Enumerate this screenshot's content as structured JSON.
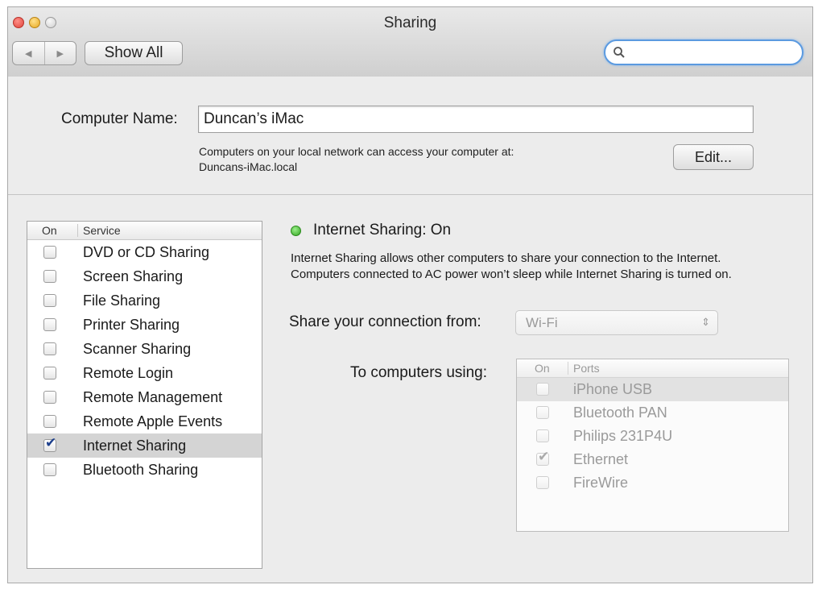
{
  "window": {
    "title": "Sharing",
    "nav_back": "◀",
    "nav_forward": "▶",
    "show_all_label": "Show All",
    "search_placeholder": "",
    "search_value": ""
  },
  "computer_name": {
    "label": "Computer Name:",
    "value": "Duncan’s iMac",
    "access_line1": "Computers on your local network can access your computer at:",
    "access_line2": "Duncans-iMac.local",
    "edit_label": "Edit..."
  },
  "services": {
    "header_on": "On",
    "header_service": "Service",
    "items": [
      {
        "label": "DVD or CD Sharing",
        "checked": false,
        "selected": false
      },
      {
        "label": "Screen Sharing",
        "checked": false,
        "selected": false
      },
      {
        "label": "File Sharing",
        "checked": false,
        "selected": false
      },
      {
        "label": "Printer Sharing",
        "checked": false,
        "selected": false
      },
      {
        "label": "Scanner Sharing",
        "checked": false,
        "selected": false
      },
      {
        "label": "Remote Login",
        "checked": false,
        "selected": false
      },
      {
        "label": "Remote Management",
        "checked": false,
        "selected": false
      },
      {
        "label": "Remote Apple Events",
        "checked": false,
        "selected": false
      },
      {
        "label": "Internet Sharing",
        "checked": true,
        "selected": true
      },
      {
        "label": "Bluetooth Sharing",
        "checked": false,
        "selected": false
      }
    ]
  },
  "detail": {
    "status_text": "Internet Sharing: On",
    "status_color": "#31a21f",
    "description": "Internet Sharing allows other computers to share your connection to the Internet. Computers connected to AC power won’t sleep while Internet Sharing is turned on.",
    "share_from_label": "Share your connection from:",
    "share_from_value": "Wi-Fi",
    "select_arrows": "⇕",
    "to_computers_label": "To computers using:",
    "ports_header_on": "On",
    "ports_header_ports": "Ports",
    "ports": [
      {
        "label": "iPhone USB",
        "checked": false,
        "selected": true
      },
      {
        "label": "Bluetooth PAN",
        "checked": false,
        "selected": false
      },
      {
        "label": "Philips 231P4U",
        "checked": false,
        "selected": false
      },
      {
        "label": "Ethernet",
        "checked": true,
        "selected": false
      },
      {
        "label": "FireWire",
        "checked": false,
        "selected": false
      }
    ]
  },
  "icons": {
    "search": "search-icon",
    "checkmark": "✔"
  }
}
